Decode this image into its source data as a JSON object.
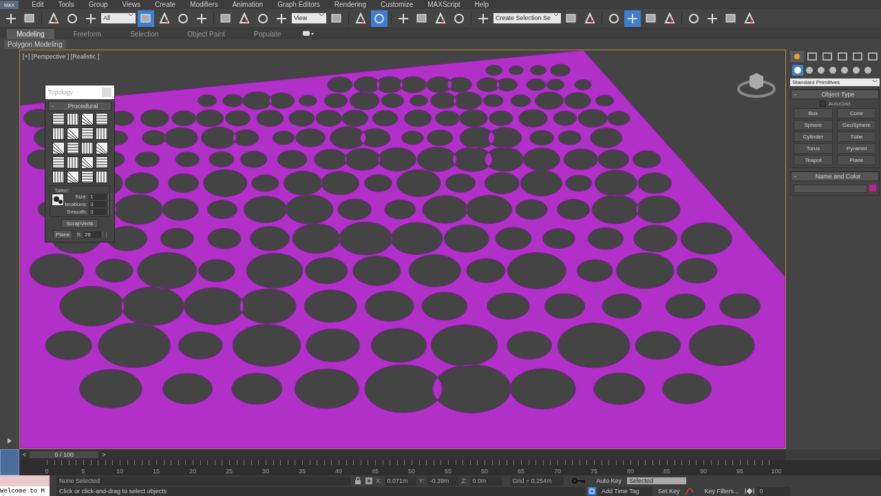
{
  "app_logo": "MAX",
  "menu": [
    "Edit",
    "Tools",
    "Group",
    "Views",
    "Create",
    "Modifiers",
    "Animation",
    "Graph Editors",
    "Rendering",
    "Customize",
    "MAXScript",
    "Help"
  ],
  "toolbar": [
    {
      "kind": "icon",
      "selected": false
    },
    {
      "kind": "icon",
      "selected": false
    },
    {
      "kind": "separator"
    },
    {
      "kind": "icon",
      "selected": false
    },
    {
      "kind": "icon",
      "selected": false
    },
    {
      "kind": "icon",
      "selected": false
    },
    {
      "kind": "dropdown",
      "value": "All"
    },
    {
      "kind": "icon",
      "selected": true
    },
    {
      "kind": "icon",
      "selected": false
    },
    {
      "kind": "icon",
      "selected": false
    },
    {
      "kind": "icon",
      "selected": false
    },
    {
      "kind": "separator"
    },
    {
      "kind": "icon",
      "selected": false
    },
    {
      "kind": "icon",
      "selected": false
    },
    {
      "kind": "icon",
      "selected": false
    },
    {
      "kind": "icon",
      "selected": false
    },
    {
      "kind": "dropdown",
      "value": "View"
    },
    {
      "kind": "icon",
      "selected": false
    },
    {
      "kind": "separator"
    },
    {
      "kind": "icon",
      "selected": false
    },
    {
      "kind": "icon",
      "selected": true
    },
    {
      "kind": "separator"
    },
    {
      "kind": "icon",
      "selected": false
    },
    {
      "kind": "icon",
      "selected": false
    },
    {
      "kind": "icon",
      "selected": false
    },
    {
      "kind": "icon",
      "selected": false
    },
    {
      "kind": "separator"
    },
    {
      "kind": "icon",
      "selected": false
    },
    {
      "kind": "dropdown",
      "value": "Create Selection Se"
    },
    {
      "kind": "icon",
      "selected": false
    },
    {
      "kind": "icon",
      "selected": false
    },
    {
      "kind": "separator"
    },
    {
      "kind": "icon",
      "selected": false
    },
    {
      "kind": "icon",
      "selected": true
    },
    {
      "kind": "icon",
      "selected": false
    },
    {
      "kind": "icon",
      "selected": false
    },
    {
      "kind": "separator"
    },
    {
      "kind": "icon",
      "selected": false
    },
    {
      "kind": "icon",
      "selected": false
    },
    {
      "kind": "icon",
      "selected": false
    },
    {
      "kind": "icon",
      "selected": false
    }
  ],
  "ribbon_tabs": [
    {
      "label": "Modeling",
      "selected": true
    },
    {
      "label": "Freeform",
      "selected": false
    },
    {
      "label": "Selection",
      "selected": false
    },
    {
      "label": "Object Paint",
      "selected": false
    },
    {
      "label": "Populate",
      "selected": false
    }
  ],
  "ribbon_panel": "Polygon Modeling",
  "viewport": {
    "label": "[+] [Perspective ] [Realistic ]"
  },
  "topology": {
    "title": "Topology",
    "rollout": {
      "toggle": "-",
      "title": "Procedural"
    },
    "tatter": {
      "label": "Tatter:",
      "fields": [
        {
          "label": "Size:",
          "value": "1"
        },
        {
          "label": "terations:",
          "value": "3"
        },
        {
          "label": "Smooth:",
          "value": "3"
        }
      ]
    },
    "scrapverts": "ScrapVerts",
    "plane": "Plane",
    "s_label": "S:",
    "s_value": "26"
  },
  "command_panel": {
    "tabs": [
      {
        "selected": true
      },
      {
        "selected": false
      },
      {
        "selected": false
      },
      {
        "selected": false
      },
      {
        "selected": false
      },
      {
        "selected": false
      }
    ],
    "categories": [
      {
        "selected": true
      },
      {
        "selected": false
      },
      {
        "selected": false
      },
      {
        "selected": false
      },
      {
        "selected": false
      },
      {
        "selected": false
      },
      {
        "selected": false
      }
    ],
    "dropdown": "Standard Primitives",
    "object_type": {
      "toggle": "-",
      "title": "Object Type",
      "autogrid": {
        "label": "AutoGrid",
        "checked": false
      },
      "buttons": [
        "Box",
        "Cone",
        "Sphere",
        "GeoSphere",
        "Cylinder",
        "Tube",
        "Torus",
        "Pyramid",
        "Teapot",
        "Plane"
      ]
    },
    "name_and_color": {
      "toggle": "-",
      "title": "Name and Color",
      "color": "#c0208a"
    }
  },
  "mini_curve_toggle": {
    "selected": true
  },
  "time_slider": {
    "prev": "<",
    "position": "0 / 100",
    "next": ">"
  },
  "ruler_labels": [
    "0",
    "5",
    "10",
    "15",
    "20",
    "25",
    "30",
    "35",
    "40",
    "45",
    "50",
    "55",
    "60",
    "65",
    "70",
    "75",
    "80",
    "85",
    "90",
    "95",
    "100"
  ],
  "listener": {
    "output": "Welcome to M"
  },
  "status": {
    "selection": "None Selected",
    "prompt": "Click or click-and-drag to select objects",
    "x_label": "X:",
    "x": "0.071m",
    "y_label": "Y:",
    "y": "-0.39m",
    "z_label": "Z:",
    "z": "0.0m",
    "grid": "Grid = 0.254m",
    "add_time_tag": "Add Time Tag",
    "auto_key": "Auto Key",
    "key_mode": "Selected",
    "set_key": "Set Key",
    "key_filters": "Key Filters...",
    "frame": "0"
  }
}
